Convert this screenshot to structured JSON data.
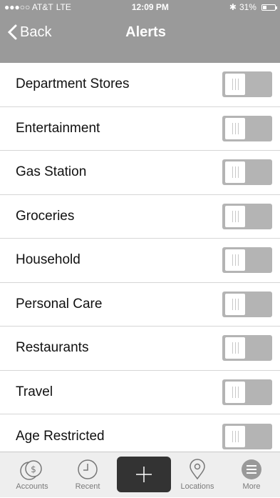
{
  "status_bar": {
    "carrier": "●●●○○ AT&T",
    "network": "LTE",
    "time": "12:09 PM",
    "bluetooth": "✱",
    "battery": "31%",
    "battery_level": 0.31
  },
  "nav": {
    "back_label": "Back",
    "title": "Alerts"
  },
  "alerts": [
    {
      "label": "Department Stores",
      "enabled": false
    },
    {
      "label": "Entertainment",
      "enabled": false
    },
    {
      "label": "Gas Station",
      "enabled": false
    },
    {
      "label": "Groceries",
      "enabled": false
    },
    {
      "label": "Household",
      "enabled": false
    },
    {
      "label": "Personal Care",
      "enabled": false
    },
    {
      "label": "Restaurants",
      "enabled": false
    },
    {
      "label": "Travel",
      "enabled": false
    },
    {
      "label": "Age Restricted",
      "enabled": false
    }
  ],
  "tab_bar": {
    "accounts": "Accounts",
    "recent": "Recent",
    "locations": "Locations",
    "more": "More"
  },
  "colors": {
    "nav_bg": "#9a9a9a",
    "toggle_off": "#b4b4b4",
    "add_button": "#333333"
  }
}
